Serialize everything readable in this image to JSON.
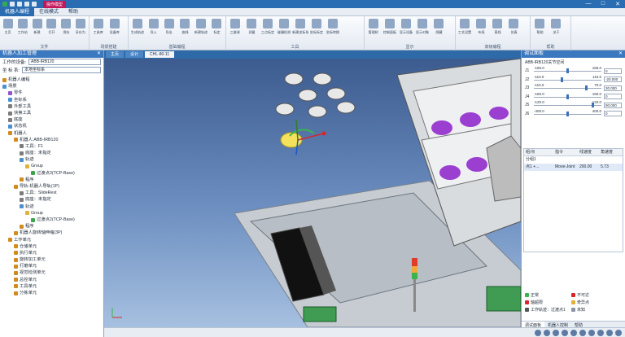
{
  "window": {
    "context_tab": "操作模型",
    "controls": [
      "—",
      "□",
      "✕"
    ]
  },
  "menu": {
    "tabs": [
      "机器人编程",
      "在线模式",
      "帮助"
    ],
    "active": 0,
    "help": "帮助"
  },
  "ribbon": {
    "groups": [
      {
        "name": "文件",
        "items": [
          "主页",
          "工作站",
          "新建",
          "打开",
          "保存",
          "另存为"
        ]
      },
      {
        "name": "场景搭建",
        "items": [
          "工具库",
          "设备库"
        ]
      },
      {
        "name": "基础编程",
        "items": [
          "生成轨迹",
          "导入",
          "导出",
          "曲线",
          "新建轨迹",
          "标定"
        ]
      },
      {
        "name": "工具",
        "items": [
          "三维球",
          "测量",
          "三点标定",
          "碰撞检测",
          "新建坐标系",
          "坐标标定",
          "坐标转换"
        ]
      },
      {
        "name": "显示",
        "items": [
          "管理树",
          "控制面板",
          "显示设备",
          "显示对象",
          "隐藏"
        ]
      },
      {
        "name": "高级编程",
        "items": [
          "工艺设置",
          "布局",
          "离线",
          "仿真"
        ]
      },
      {
        "name": "帮助",
        "items": [
          "帮助",
          "关于"
        ]
      }
    ]
  },
  "left_panel": {
    "title": "机器人加工管理",
    "robot_label": "工作的设备:",
    "robot_value": "ABB-IRB120",
    "coord_label": "坐 标 系:",
    "coord_value": "本地坐标系",
    "tree": [
      {
        "label": "机器人编程",
        "level": 0,
        "color": "#d18b1f"
      },
      {
        "label": "场景",
        "level": 0,
        "color": "#4a8fd0"
      },
      {
        "label": "零件",
        "level": 1,
        "color": "#8f56c9"
      },
      {
        "label": "坐标系",
        "level": 1,
        "color": "#4a8fd0"
      },
      {
        "label": "外部工具",
        "level": 1,
        "color": "#7c7c7c"
      },
      {
        "label": "快换工具",
        "level": 1,
        "color": "#7c7c7c"
      },
      {
        "label": "底座",
        "level": 1,
        "color": "#7c7c7c"
      },
      {
        "label": "状态机",
        "level": 1,
        "color": "#4a8fd0"
      },
      {
        "label": "机器人",
        "level": 1,
        "color": "#d18b1f"
      },
      {
        "label": "机器人:ABB-IRB120",
        "level": 2,
        "color": "#d18b1f"
      },
      {
        "label": "工具：F1",
        "level": 3,
        "color": "#7c7c7c"
      },
      {
        "label": "底座：未指定",
        "level": 3,
        "color": "#7c7c7c"
      },
      {
        "label": "轨迹",
        "level": 3,
        "color": "#4a8fd0"
      },
      {
        "label": "Group",
        "level": 4,
        "color": "#e0b23b"
      },
      {
        "label": "过渡点3(TCP-Base)",
        "level": 5,
        "color": "#3ea34a"
      },
      {
        "label": "程序",
        "level": 3,
        "color": "#d18b1f"
      },
      {
        "label": "导轨-机器人导轨(1P)",
        "level": 2,
        "color": "#d18b1f"
      },
      {
        "label": "工具：SlideRest",
        "level": 3,
        "color": "#7c7c7c"
      },
      {
        "label": "底座：未指定",
        "level": 3,
        "color": "#7c7c7c"
      },
      {
        "label": "轨迹",
        "level": 3,
        "color": "#4a8fd0"
      },
      {
        "label": "Group",
        "level": 4,
        "color": "#e0b23b"
      },
      {
        "label": "过渡点2(TCP-Base)",
        "level": 5,
        "color": "#3ea34a"
      },
      {
        "label": "程序",
        "level": 3,
        "color": "#d18b1f"
      },
      {
        "label": "机器人旋转轴伸缩(3P)",
        "level": 2,
        "color": "#d18b1f"
      },
      {
        "label": "工作单元",
        "level": 1,
        "color": "#d18b1f"
      },
      {
        "label": "仓储单元",
        "level": 2,
        "color": "#d18b1f"
      },
      {
        "label": "执行单元",
        "level": 2,
        "color": "#d18b1f"
      },
      {
        "label": "旋转加工单元",
        "level": 2,
        "color": "#d18b1f"
      },
      {
        "label": "打磨单元",
        "level": 2,
        "color": "#d18b1f"
      },
      {
        "label": "视觉检测单元",
        "level": 2,
        "color": "#d18b1f"
      },
      {
        "label": "总控单元",
        "level": 2,
        "color": "#d18b1f"
      },
      {
        "label": "工具单元",
        "level": 2,
        "color": "#d18b1f"
      },
      {
        "label": "分拣单元",
        "level": 2,
        "color": "#d18b1f"
      }
    ]
  },
  "viewport": {
    "tabs": [
      {
        "label": "主页"
      },
      {
        "label": "设计"
      },
      {
        "label": "CHL-80-11"
      }
    ],
    "active_tab": 2
  },
  "right_panel": {
    "title": "调试面板",
    "joint_title": "ABB-IRB120关节空间",
    "joints": [
      {
        "name": "J1",
        "min": "-165.0",
        "max": "165.0",
        "pos": 0.5,
        "value": "0"
      },
      {
        "name": "J2",
        "min": "-110.0",
        "max": "110.0",
        "pos": 0.41,
        "value": "-20.000"
      },
      {
        "name": "J3",
        "min": "-110.0",
        "max": "70.0",
        "pos": 0.78,
        "value": "30.000"
      },
      {
        "name": "J4",
        "min": "-160.0",
        "max": "160.0",
        "pos": 0.5,
        "value": "0"
      },
      {
        "name": "J5",
        "min": "-120.0",
        "max": "120.0",
        "pos": 0.87,
        "value": "90.000"
      },
      {
        "name": "J6",
        "min": "-400.0",
        "max": "400.0",
        "pos": 0.5,
        "value": "0"
      }
    ],
    "table_headers": [
      "组/点",
      "指令",
      "线速度",
      "角速度"
    ],
    "table_rows": [
      {
        "a": "分组1",
        "b": "",
        "c": "",
        "d": ""
      },
      {
        "a": "点1 +...",
        "b": "Move-Joint",
        "c": "200.00",
        "d": "5.73"
      }
    ],
    "options": [
      [
        "正常",
        "不可达"
      ],
      [
        "轴超限",
        "奇异点"
      ],
      [
        "工作轨迹：过渡点1",
        "未知"
      ]
    ],
    "bottom_tabs": [
      "调试面板",
      "机器人控制",
      "帮助"
    ],
    "active_bottom_tab": 0
  }
}
